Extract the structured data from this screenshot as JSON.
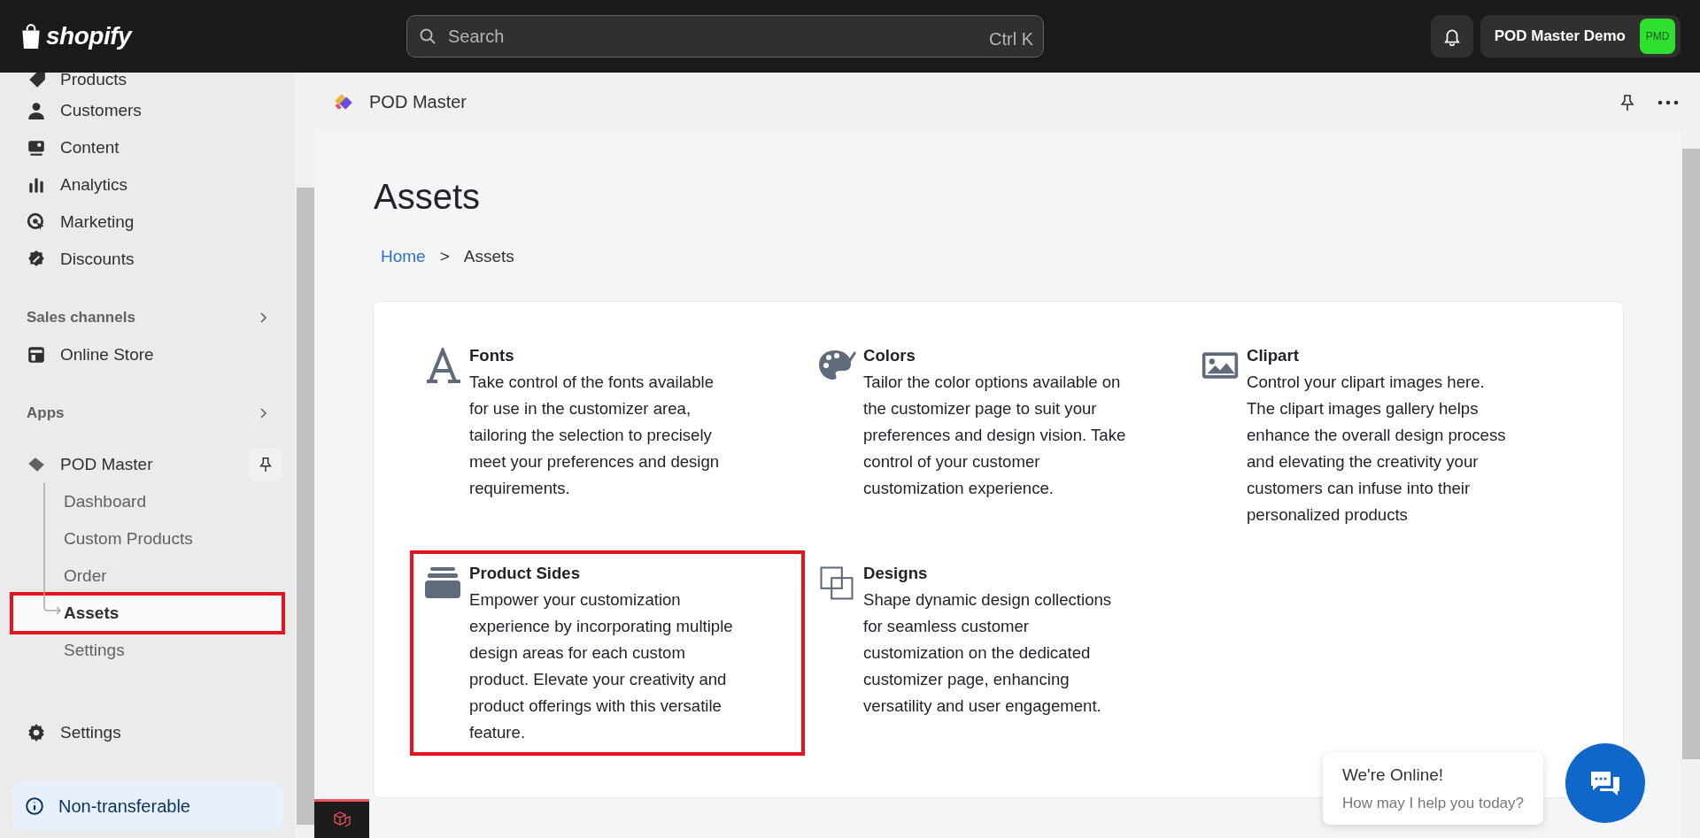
{
  "topbar": {
    "logo": "shopify",
    "search": {
      "placeholder": "Search",
      "shortcut": "Ctrl K"
    },
    "store": {
      "name": "POD Master Demo",
      "avatar": "PMD"
    }
  },
  "sidebar": {
    "main_items": [
      {
        "label": "Products"
      },
      {
        "label": "Customers"
      },
      {
        "label": "Content"
      },
      {
        "label": "Analytics"
      },
      {
        "label": "Marketing"
      },
      {
        "label": "Discounts"
      }
    ],
    "sales_channels": {
      "title": "Sales channels",
      "items": [
        {
          "label": "Online Store"
        }
      ]
    },
    "apps": {
      "title": "Apps",
      "app": {
        "label": "POD Master",
        "children": [
          {
            "label": "Dashboard",
            "selected": false,
            "highlighted": false
          },
          {
            "label": "Custom Products",
            "selected": false,
            "highlighted": false
          },
          {
            "label": "Order",
            "selected": false,
            "highlighted": false
          },
          {
            "label": "Assets",
            "selected": true,
            "highlighted": true
          },
          {
            "label": "Settings",
            "selected": false,
            "highlighted": false
          }
        ]
      }
    },
    "settings": "Settings",
    "notice": "Non-transferable"
  },
  "app_header": {
    "title": "POD Master"
  },
  "page": {
    "title": "Assets",
    "breadcrumb": [
      {
        "label": "Home",
        "link": true
      },
      {
        "label": ">",
        "link": false
      },
      {
        "label": "Assets",
        "link": false
      }
    ],
    "tiles": [
      {
        "title": "Fonts",
        "text": "Take control of the fonts available for use in the customizer area, tailoring the selection to precisely meet your preferences and design requirements.",
        "highlighted": false
      },
      {
        "title": "Colors",
        "text": "Tailor the color options available on the customizer page to suit your preferences and design vision. Take control of your customer customization experience.",
        "highlighted": false
      },
      {
        "title": "Clipart",
        "text": "Control your clipart images here. The clipart images gallery helps enhance the overall design process and elevating the creativity your customers can infuse into their personalized products",
        "highlighted": false
      },
      {
        "title": "Product Sides",
        "text": "Empower your customization experience by incorporating multiple design areas for each custom product. Elevate your creativity and product offerings with this versatile feature.",
        "highlighted": true
      },
      {
        "title": "Designs",
        "text": "Shape dynamic design collections for seamless customer customization on the dedicated customizer page, enhancing versatility and user engagement.",
        "highlighted": false
      }
    ]
  },
  "chat": {
    "title": "We're Online!",
    "subtitle": "How may I help you today?"
  }
}
